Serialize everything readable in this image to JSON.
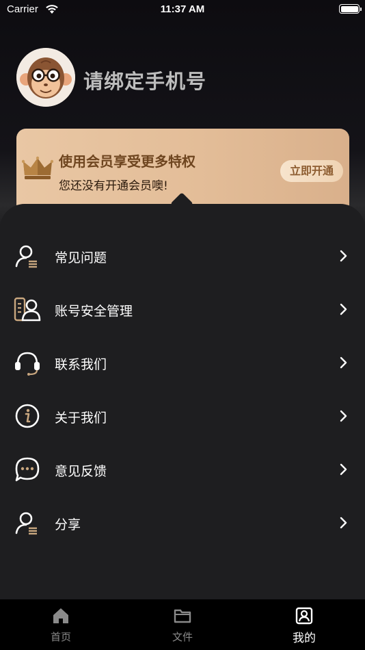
{
  "status_bar": {
    "carrier": "Carrier",
    "time": "11:37 AM"
  },
  "profile": {
    "name": "请绑定手机号"
  },
  "vip": {
    "title": "使用会员享受更多特权",
    "subtitle": "您还没有开通会员噢!",
    "button": "立即开通"
  },
  "menu": [
    {
      "label": "常见问题",
      "icon": "user-list-icon"
    },
    {
      "label": "账号安全管理",
      "icon": "account-security-icon"
    },
    {
      "label": "联系我们",
      "icon": "headset-icon"
    },
    {
      "label": "关于我们",
      "icon": "info-icon"
    },
    {
      "label": "意见反馈",
      "icon": "chat-bubble-icon"
    },
    {
      "label": "分享",
      "icon": "share-user-icon"
    }
  ],
  "tabs": [
    {
      "label": "首页",
      "icon": "home-icon"
    },
    {
      "label": "文件",
      "icon": "folder-icon"
    },
    {
      "label": "我的",
      "icon": "profile-icon",
      "active": true
    }
  ],
  "colors": {
    "accent_gold": "#c9a77f",
    "vip_title": "#6e451f",
    "panel_bg": "#1e1e20"
  }
}
